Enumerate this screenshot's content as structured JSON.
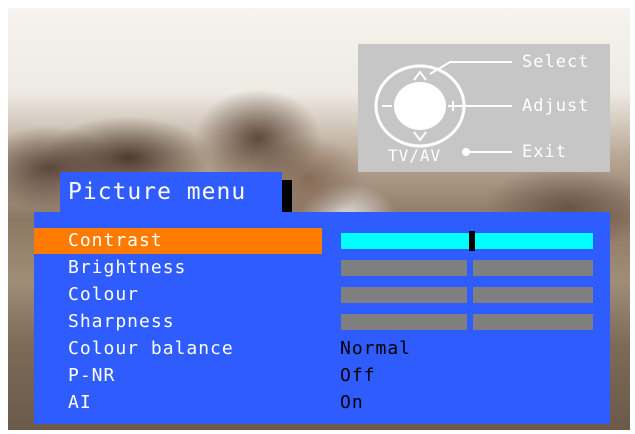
{
  "help": {
    "select": "Select",
    "adjust": "Adjust",
    "exit": "Exit",
    "tvav": "TV/AV"
  },
  "menu": {
    "title": "Picture menu",
    "items": [
      {
        "label": "Contrast",
        "type": "slider",
        "selected": true,
        "level": 0.52
      },
      {
        "label": "Brightness",
        "type": "slider",
        "selected": false
      },
      {
        "label": "Colour",
        "type": "slider",
        "selected": false
      },
      {
        "label": "Sharpness",
        "type": "slider",
        "selected": false
      },
      {
        "label": "Colour balance",
        "type": "value",
        "value": "Normal"
      },
      {
        "label": "P-NR",
        "type": "value",
        "value": "Off"
      },
      {
        "label": "AI",
        "type": "value",
        "value": "On"
      }
    ]
  },
  "colors": {
    "panel": "#2f5cff",
    "highlight": "#ff7a00",
    "active_slider": "#00ffff",
    "inactive_slider": "#7f7f7f"
  }
}
